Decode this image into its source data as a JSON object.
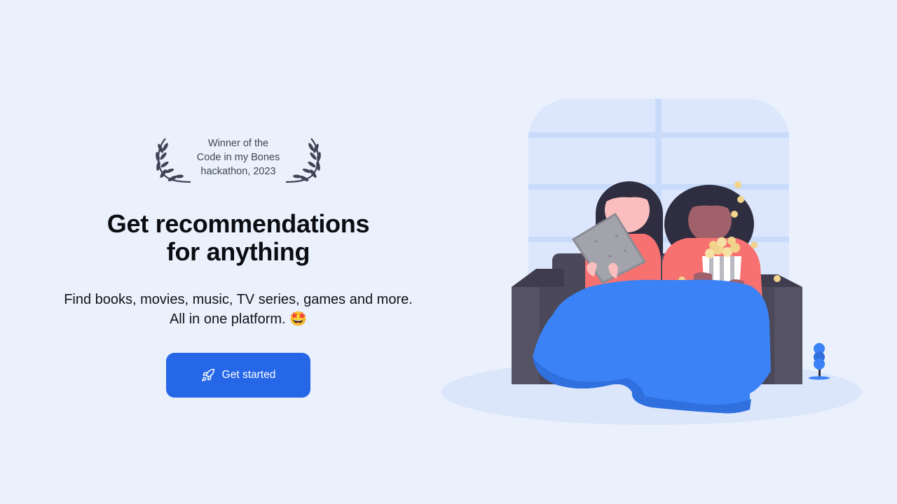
{
  "award": {
    "lines": [
      "Winner of the",
      "Code in my Bones",
      "hackathon, 2023"
    ],
    "icon": "laurel-wreath-icon"
  },
  "hero": {
    "headline_lines": [
      "Get recommendations",
      "for anything"
    ],
    "subtitle_lines": [
      "Find books, movies, music, TV series, games and more.",
      "All in one platform. 🤩"
    ],
    "cta_label": "Get started",
    "cta_icon": "rocket-icon"
  },
  "colors": {
    "background": "#eaf1fc",
    "accent": "#2667e8",
    "blanket": "#3b82f6",
    "sofa": "#4b4859"
  }
}
